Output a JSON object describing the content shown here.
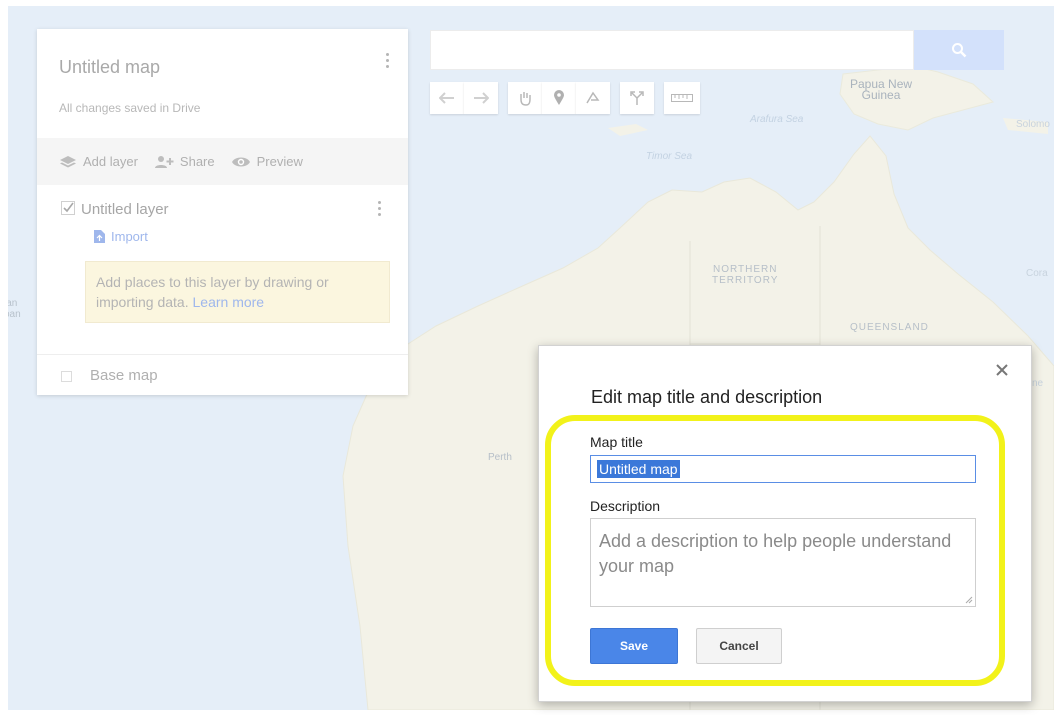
{
  "map": {
    "labels": {
      "papua": "Papua New\nGuinea",
      "northern_territory": "NORTHERN\nTERRITORY",
      "queensland": "QUEENSLAND",
      "perth": "Perth",
      "arafura_sea": "Arafura Sea",
      "timor_sea": "Timor Sea",
      "solomon": "Solomo",
      "coral": "Cora",
      "ne": "ne",
      "edge_left": "lan\noan"
    }
  },
  "panel": {
    "title": "Untitled map",
    "saved_status": "All changes saved in Drive",
    "toolbar": {
      "add_layer": "Add layer",
      "share": "Share",
      "preview": "Preview"
    },
    "layer": {
      "name": "Untitled layer",
      "import": "Import",
      "hint_text": "Add places to this layer by drawing or importing data.",
      "learn_more": "Learn more"
    },
    "base_map": "Base map"
  },
  "search": {
    "value": ""
  },
  "dialog": {
    "heading": "Edit map title and description",
    "title_label": "Map title",
    "title_value": "Untitled map",
    "description_label": "Description",
    "description_placeholder": "Add a description to help people understand your map",
    "save_label": "Save",
    "cancel_label": "Cancel"
  },
  "colors": {
    "primary_button": "#4a86e8",
    "highlight": "#f2f21a",
    "link": "#9fb7ec"
  }
}
